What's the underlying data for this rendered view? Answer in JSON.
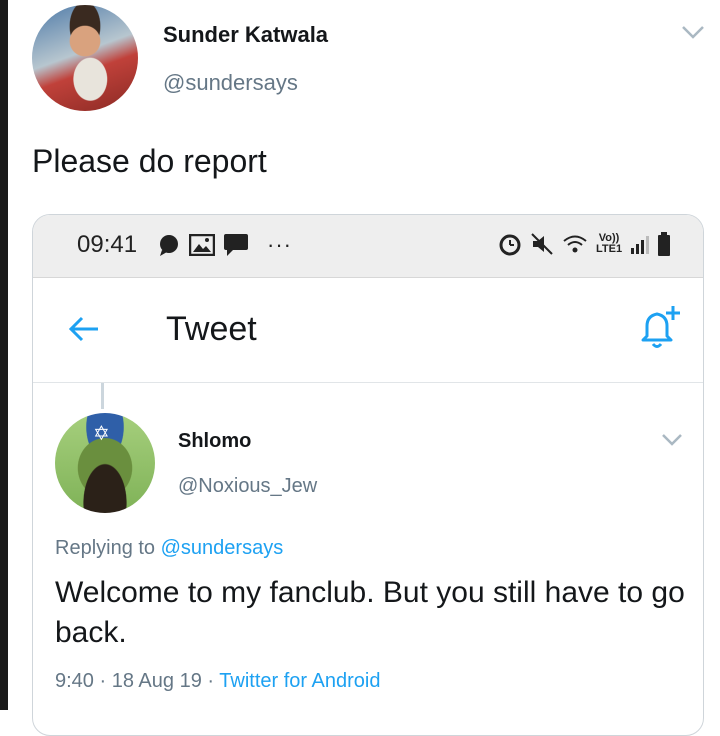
{
  "outer_tweet": {
    "name": "Sunder Katwala",
    "handle": "@sundersays",
    "text": "Please do report"
  },
  "screenshot": {
    "status_bar": {
      "time": "09:41",
      "ellipsis": "···",
      "network_label_top": "Vo))",
      "network_label_bottom": "LTE1"
    },
    "app_bar": {
      "title": "Tweet"
    },
    "tweet": {
      "name": "Shlomo",
      "handle": "@Noxious_Jew",
      "replying_prefix": "Replying to",
      "replying_to": "@sundersays",
      "text": "Welcome to my fanclub. But you still have to go back.",
      "time": "9:40",
      "separator": "·",
      "date": "18 Aug 19",
      "source": "Twitter for Android"
    }
  },
  "colors": {
    "link_blue": "#1da1f2",
    "secondary_text": "#657786",
    "status_bar_bg": "#eeeeee"
  }
}
